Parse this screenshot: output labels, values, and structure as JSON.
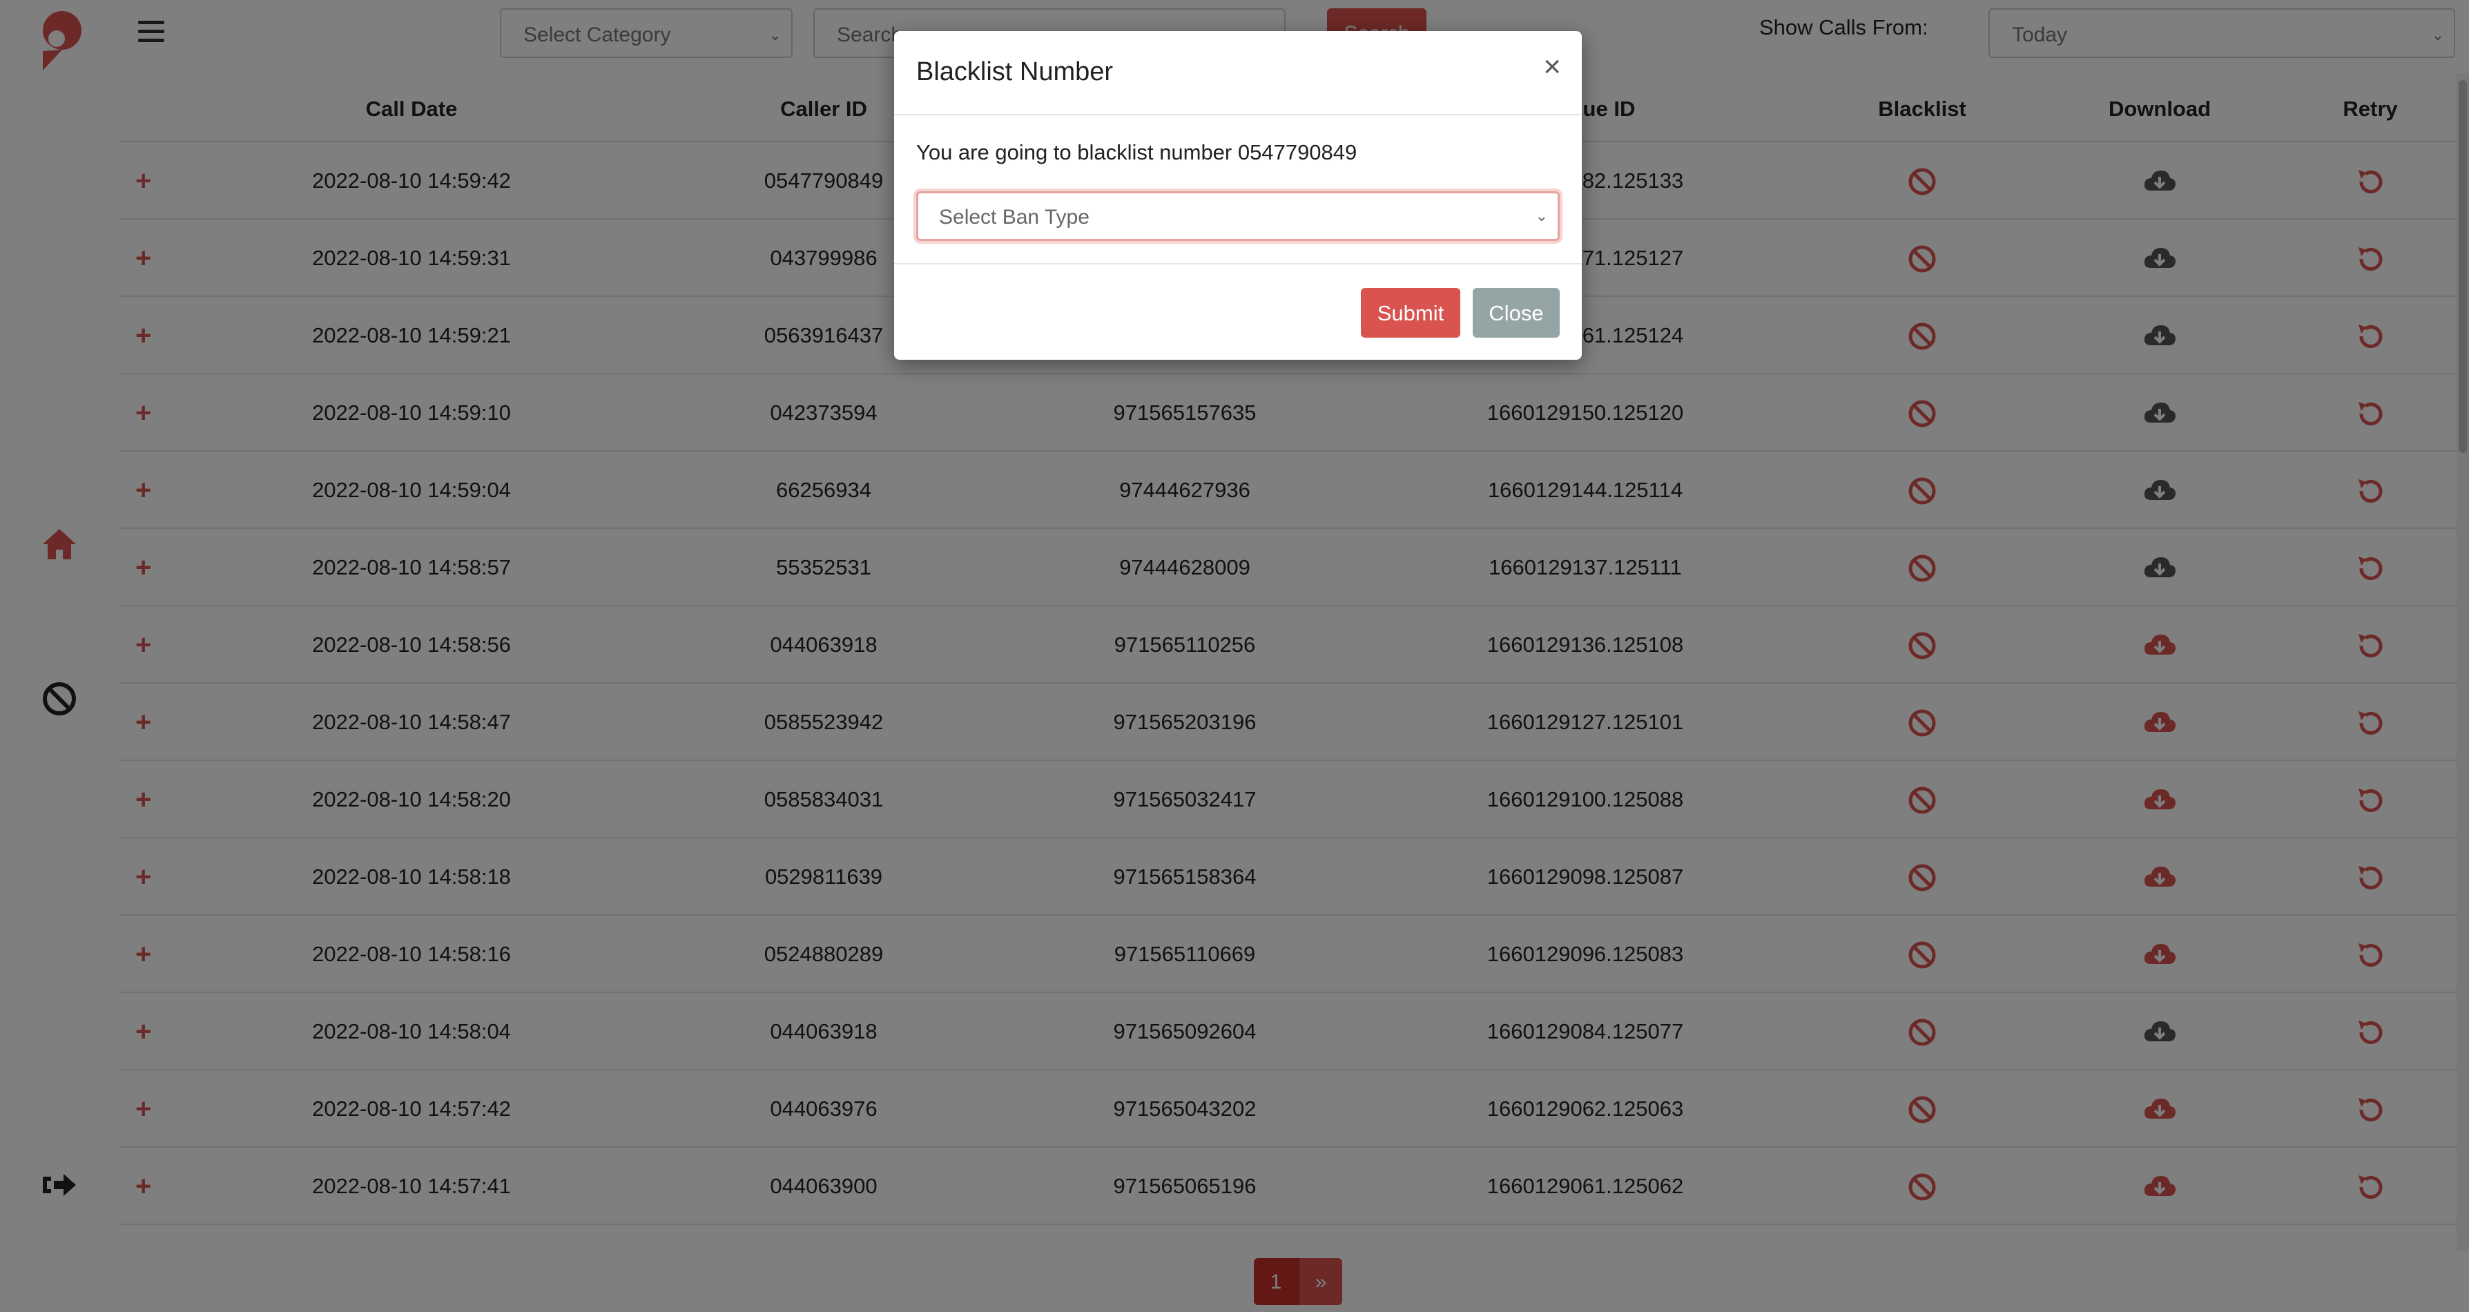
{
  "topbar": {
    "category_placeholder": "Select Category",
    "search_placeholder": "Search",
    "search_button": "Search",
    "show_calls_label": "Show Calls From:",
    "show_calls_value": "Today"
  },
  "table": {
    "headers": {
      "call_date": "Call Date",
      "caller_id": "Caller ID",
      "unique_id": "Unique ID",
      "blacklist": "Blacklist",
      "download": "Download",
      "retry": "Retry"
    },
    "rows": [
      {
        "date": "2022-08-10 14:59:42",
        "caller": "0547790849",
        "dest": "",
        "uid": "1660129182.125133"
      },
      {
        "date": "2022-08-10 14:59:31",
        "caller": "043799986",
        "dest": "",
        "uid": "1660129171.125127"
      },
      {
        "date": "2022-08-10 14:59:21",
        "caller": "0563916437",
        "dest": "",
        "uid": "1660129161.125124"
      },
      {
        "date": "2022-08-10 14:59:10",
        "caller": "042373594",
        "dest": "971565157635",
        "uid": "1660129150.125120"
      },
      {
        "date": "2022-08-10 14:59:04",
        "caller": "66256934",
        "dest": "97444627936",
        "uid": "1660129144.125114"
      },
      {
        "date": "2022-08-10 14:58:57",
        "caller": "55352531",
        "dest": "97444628009",
        "uid": "1660129137.125111"
      },
      {
        "date": "2022-08-10 14:58:56",
        "caller": "044063918",
        "dest": "971565110256",
        "uid": "1660129136.125108"
      },
      {
        "date": "2022-08-10 14:58:47",
        "caller": "0585523942",
        "dest": "971565203196",
        "uid": "1660129127.125101"
      },
      {
        "date": "2022-08-10 14:58:20",
        "caller": "0585834031",
        "dest": "971565032417",
        "uid": "1660129100.125088"
      },
      {
        "date": "2022-08-10 14:58:18",
        "caller": "0529811639",
        "dest": "971565158364",
        "uid": "1660129098.125087"
      },
      {
        "date": "2022-08-10 14:58:16",
        "caller": "0524880289",
        "dest": "971565110669",
        "uid": "1660129096.125083"
      },
      {
        "date": "2022-08-10 14:58:04",
        "caller": "044063918",
        "dest": "971565092604",
        "uid": "1660129084.125077"
      },
      {
        "date": "2022-08-10 14:57:42",
        "caller": "044063976",
        "dest": "971565043202",
        "uid": "1660129062.125063"
      },
      {
        "date": "2022-08-10 14:57:41",
        "caller": "044063900",
        "dest": "971565065196",
        "uid": "1660129061.125062"
      }
    ],
    "row_plus": "+"
  },
  "pagination": {
    "current": "1",
    "next": "»"
  },
  "modal": {
    "title": "Blacklist Number",
    "close_symbol": "×",
    "message": "You are going to blacklist number 0547790849",
    "ban_placeholder": "Select Ban Type",
    "submit_label": "Submit",
    "close_label": "Close"
  },
  "colors": {
    "accent": "#d9534f",
    "overlay": "rgba(0,0,0,0.5)",
    "close_button": "#95a5a6"
  },
  "icons": {
    "logo": "brand-logo",
    "home": "home-icon",
    "ban": "ban-icon",
    "logout": "logout-icon",
    "blacklist": "ban-icon",
    "download": "cloud-download-icon",
    "retry": "retry-icon"
  }
}
